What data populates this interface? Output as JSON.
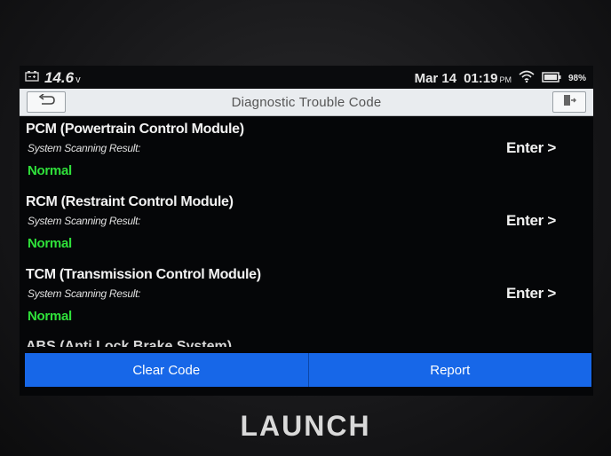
{
  "statusbar": {
    "voltage": "14.6",
    "voltage_unit": "v",
    "date": "Mar 14",
    "time": "01:19",
    "ampm": "PM",
    "battery": "98%"
  },
  "titlebar": {
    "title": "Diagnostic Trouble Code"
  },
  "modules": [
    {
      "name": "PCM (Powertrain Control Module)",
      "scan_label": "System Scanning Result:",
      "result": "Normal",
      "enter": "Enter >"
    },
    {
      "name": "RCM (Restraint Control Module)",
      "scan_label": "System Scanning Result:",
      "result": "Normal",
      "enter": "Enter >"
    },
    {
      "name": "TCM (Transmission Control Module)",
      "scan_label": "System Scanning Result:",
      "result": "Normal",
      "enter": "Enter >"
    }
  ],
  "partial_module": {
    "name": "ABS (Anti Lock Brake System)"
  },
  "actions": {
    "clear_code": "Clear Code",
    "report": "Report"
  },
  "brand": "LAUNCH",
  "colors": {
    "accent_blue": "#1767e8",
    "status_green": "#2fe03a",
    "title_bar": "#e9ecef"
  }
}
